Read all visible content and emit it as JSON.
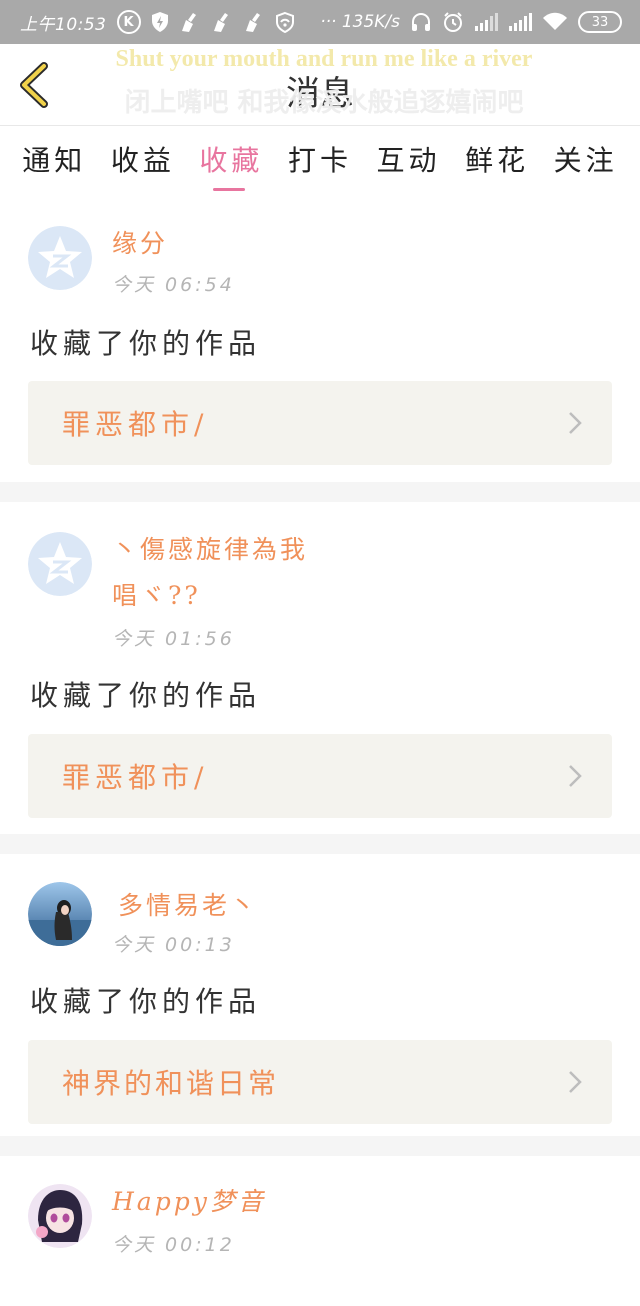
{
  "status_bar": {
    "time": "上午10:53",
    "network_speed": "··· 135K/s",
    "battery": "33",
    "icons": [
      "k-icon",
      "shield-icon",
      "broom-icon",
      "broom-icon",
      "broom-icon",
      "vpn-shield-icon",
      "headphones-icon",
      "alarm-icon",
      "signal-icon",
      "signal-icon",
      "wifi-icon",
      "battery-icon"
    ]
  },
  "header": {
    "title": "消息",
    "lyric_en": "Shut your mouth and run me like a river",
    "lyric_cn": "闭上嘴吧 和我像溪水般追逐嬉闹吧"
  },
  "tabs": [
    {
      "label": "通知"
    },
    {
      "label": "收益"
    },
    {
      "label": "收藏"
    },
    {
      "label": "打卡"
    },
    {
      "label": "互动"
    },
    {
      "label": "鲜花"
    },
    {
      "label": "关注"
    }
  ],
  "active_tab": "收藏",
  "colors": {
    "accent": "#e8759f",
    "orange": "#f0915a",
    "status_bar": "#a9a9a9",
    "work_box_bg": "#f4f3ee"
  },
  "feed": [
    {
      "user": "缘分",
      "user_line2": "",
      "time": "今天 06:54",
      "action": "收藏了你的作品",
      "work": "罪恶都市/",
      "avatar": "qzone-default-avatar"
    },
    {
      "user": "丶傷感旋律為我",
      "user_line2": "唱ヾ??",
      "time": "今天 01:56",
      "action": "收藏了你的作品",
      "work": "罪恶都市/",
      "avatar": "qzone-default-avatar"
    },
    {
      "user": "多情易老丶",
      "user_line2": "",
      "time": "今天 00:13",
      "action": "收藏了你的作品",
      "work": "神界的和谐日常",
      "avatar": "girl-photo-avatar"
    },
    {
      "user": "Happy梦音",
      "user_line2": "",
      "time": "今天 00:12",
      "action": "",
      "work": "",
      "avatar": "anime-girl-avatar"
    }
  ]
}
